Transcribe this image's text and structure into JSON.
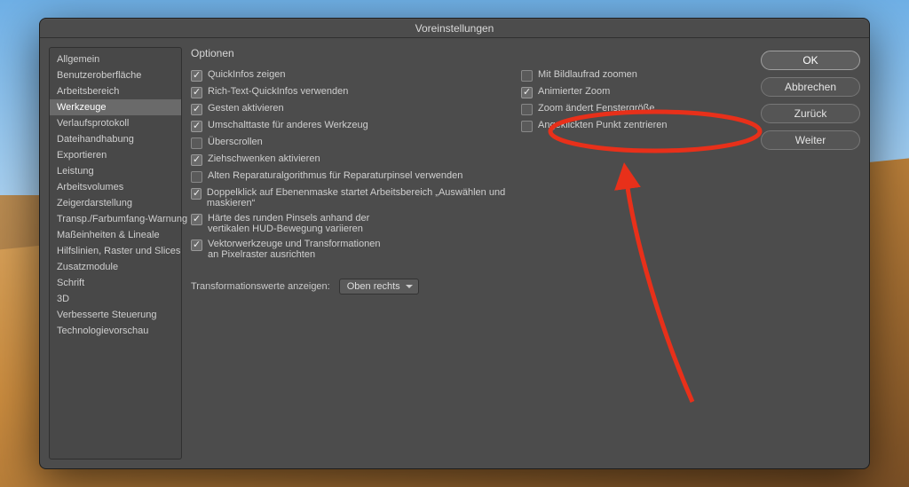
{
  "window": {
    "title": "Voreinstellungen"
  },
  "sidebar": {
    "items": [
      "Allgemein",
      "Benutzeroberfläche",
      "Arbeitsbereich",
      "Werkzeuge",
      "Verlaufsprotokoll",
      "Dateihandhabung",
      "Exportieren",
      "Leistung",
      "Arbeitsvolumes",
      "Zeigerdarstellung",
      "Transp./Farbumfang-Warnung",
      "Maßeinheiten & Lineale",
      "Hilfslinien, Raster und Slices",
      "Zusatzmodule",
      "Schrift",
      "3D",
      "Verbesserte Steuerung",
      "Technologievorschau"
    ],
    "selected_index": 3
  },
  "options": {
    "heading": "Optionen",
    "left": [
      {
        "label": "QuickInfos zeigen",
        "checked": true
      },
      {
        "label": "Rich-Text-QuickInfos verwenden",
        "checked": true
      },
      {
        "label": "Gesten aktivieren",
        "checked": true
      },
      {
        "label": "Umschalttaste für anderes Werkzeug",
        "checked": true
      },
      {
        "label": "Überscrollen",
        "checked": false
      },
      {
        "label": "Ziehschwenken aktivieren",
        "checked": true
      },
      {
        "label": "Alten Reparaturalgorithmus für Reparaturpinsel verwenden",
        "checked": false
      },
      {
        "label": "Doppelklick auf Ebenenmaske startet Arbeitsbereich „Auswählen und maskieren“",
        "checked": true
      },
      {
        "label": "Härte des runden Pinsels anhand der\nvertikalen HUD-Bewegung variieren",
        "checked": true
      },
      {
        "label": "Vektorwerkzeuge und Transformationen\nan Pixelraster ausrichten",
        "checked": true
      }
    ],
    "right": [
      {
        "label": "Mit Bildlaufrad zoomen",
        "checked": false
      },
      {
        "label": "Animierter Zoom",
        "checked": true
      },
      {
        "label": "Zoom ändert Fenstergröße",
        "checked": false
      },
      {
        "label": "Angeklickten Punkt zentrieren",
        "checked": false
      }
    ],
    "transform": {
      "label": "Transformationswerte anzeigen:",
      "value": "Oben rechts"
    }
  },
  "buttons": {
    "ok": "OK",
    "cancel": "Abbrechen",
    "prev": "Zurück",
    "next": "Weiter"
  },
  "annotation_color": "#e8301a"
}
